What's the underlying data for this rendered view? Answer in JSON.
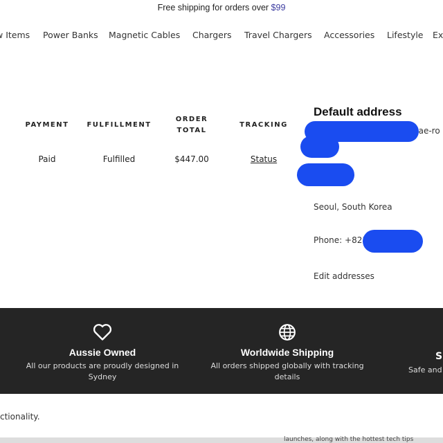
{
  "banner": {
    "text": "Free shipping for orders over ",
    "amount": "$99"
  },
  "nav": [
    "w Items",
    "Power Banks",
    "Magnetic Cables",
    "Chargers",
    "Travel Chargers",
    "Accessories",
    "Lifestyle",
    "Exp"
  ],
  "orders": {
    "headers": [
      "PAYMENT",
      "FULFILLMENT",
      "ORDER TOTAL",
      "TRACKING"
    ],
    "row": [
      "Paid",
      "Fulfilled",
      "$447.00",
      "Status"
    ]
  },
  "address": {
    "title": "Default address",
    "line1_visible": "dae-ro",
    "city": "Seoul, South Korea",
    "phone": "Phone: +821",
    "edit": "Edit addresses"
  },
  "features": [
    {
      "icon": "heart-icon",
      "title": "Aussie Owned",
      "text": "All our products are proudly designed in Sydney"
    },
    {
      "icon": "globe-icon",
      "title": "Worldwide Shipping",
      "text": "All orders shipped globally with tracking details"
    },
    {
      "icon": "",
      "title": "S",
      "text": "Safe and"
    }
  ],
  "footer": {
    "text": "ctionality.",
    "newsletter": "launches, along with the hottest tech tips"
  }
}
